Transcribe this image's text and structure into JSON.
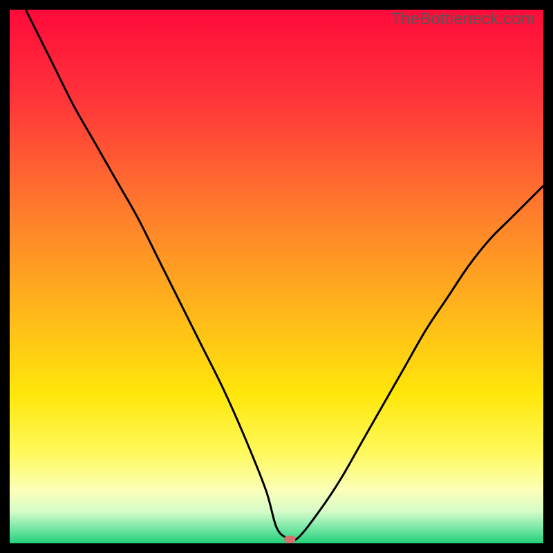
{
  "watermark": "TheBottleneck.com",
  "chart_data": {
    "type": "line",
    "title": "",
    "xlabel": "",
    "ylabel": "",
    "xlim": [
      0,
      100
    ],
    "ylim": [
      0,
      100
    ],
    "series": [
      {
        "name": "bottleneck-curve",
        "x": [
          3,
          8,
          12,
          16,
          20,
          24,
          28,
          32,
          36,
          40,
          44,
          48,
          50,
          52,
          54,
          58,
          62,
          66,
          70,
          74,
          78,
          82,
          86,
          90,
          94,
          100
        ],
        "y": [
          100,
          90,
          82,
          75,
          68,
          61,
          53,
          45,
          37,
          29,
          20,
          10,
          3,
          1,
          1,
          6,
          12,
          19,
          26,
          33,
          40,
          46,
          52,
          57,
          61,
          67
        ]
      }
    ],
    "marker": {
      "x": 52.5,
      "y": 0.8
    },
    "gradient_stops": [
      {
        "pct": 0,
        "color": "#ff0a3b"
      },
      {
        "pct": 18,
        "color": "#ff3839"
      },
      {
        "pct": 38,
        "color": "#ff7d2c"
      },
      {
        "pct": 55,
        "color": "#ffb21c"
      },
      {
        "pct": 72,
        "color": "#ffe70a"
      },
      {
        "pct": 83,
        "color": "#fff95c"
      },
      {
        "pct": 90,
        "color": "#fcffb8"
      },
      {
        "pct": 94,
        "color": "#d6fcc8"
      },
      {
        "pct": 97,
        "color": "#7ce9a8"
      },
      {
        "pct": 100,
        "color": "#21d07b"
      }
    ]
  }
}
